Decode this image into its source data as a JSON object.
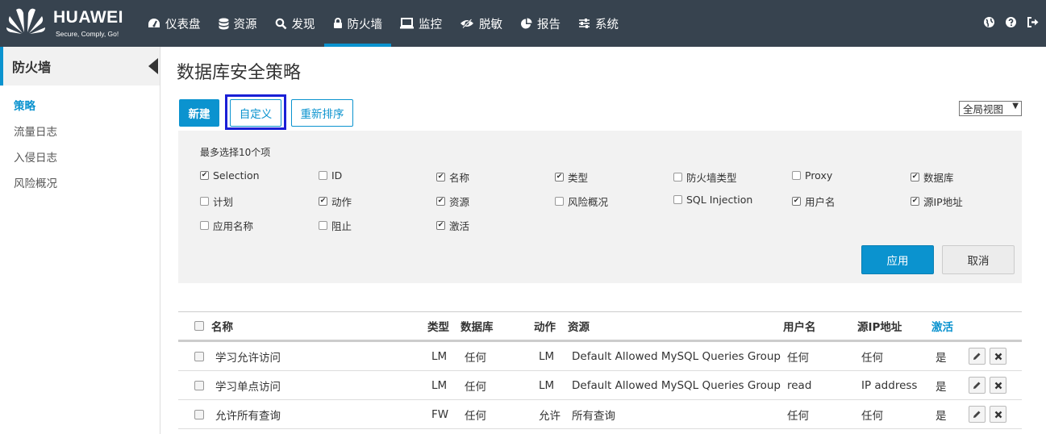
{
  "brand": {
    "name": "HUAWEI",
    "slogan": "Secure, Comply, Go!"
  },
  "nav": [
    {
      "label": "仪表盘",
      "icon": "dashboard-icon"
    },
    {
      "label": "资源",
      "icon": "database-icon"
    },
    {
      "label": "发现",
      "icon": "search-icon"
    },
    {
      "label": "防火墙",
      "icon": "lock-icon",
      "active": true
    },
    {
      "label": "监控",
      "icon": "monitor-icon"
    },
    {
      "label": "脱敏",
      "icon": "eye-slash-icon"
    },
    {
      "label": "报告",
      "icon": "pie-chart-icon"
    },
    {
      "label": "系统",
      "icon": "sliders-icon"
    }
  ],
  "top_icons": [
    "globe-icon",
    "help-icon",
    "logout-icon"
  ],
  "sidebar": {
    "title": "防火墙",
    "items": [
      {
        "label": "策略",
        "active": true
      },
      {
        "label": "流量日志"
      },
      {
        "label": "入侵日志"
      },
      {
        "label": "风险概况"
      }
    ]
  },
  "page": {
    "title": "数据库安全策略"
  },
  "toolbar": {
    "new_label": "新建",
    "custom_label": "自定义",
    "reorder_label": "重新排序"
  },
  "view_select": {
    "value": "全局视图"
  },
  "custom_panel": {
    "hint": "最多选择10个项",
    "options": [
      {
        "label": "Selection",
        "checked": true
      },
      {
        "label": "ID",
        "checked": false
      },
      {
        "label": "名称",
        "checked": true
      },
      {
        "label": "类型",
        "checked": true
      },
      {
        "label": "防火墙类型",
        "checked": false
      },
      {
        "label": "Proxy",
        "checked": false
      },
      {
        "label": "数据库",
        "checked": true
      },
      {
        "label": "计划",
        "checked": false
      },
      {
        "label": "动作",
        "checked": true
      },
      {
        "label": "资源",
        "checked": true
      },
      {
        "label": "风险概况",
        "checked": false
      },
      {
        "label": "SQL Injection",
        "checked": false
      },
      {
        "label": "用户名",
        "checked": true
      },
      {
        "label": "源IP地址",
        "checked": true
      },
      {
        "label": "应用名称",
        "checked": false
      },
      {
        "label": "阻止",
        "checked": false
      },
      {
        "label": "激活",
        "checked": true
      }
    ],
    "apply_label": "应用",
    "cancel_label": "取消"
  },
  "table": {
    "columns": [
      "名称",
      "类型",
      "数据库",
      "动作",
      "资源",
      "用户名",
      "源IP地址",
      "激活"
    ],
    "rows": [
      [
        "学习允许访问",
        "LM",
        "任何",
        "LM",
        "Default Allowed MySQL Queries Group",
        "任何",
        "任何",
        "是"
      ],
      [
        "学习单点访问",
        "LM",
        "任何",
        "LM",
        "Default Allowed MySQL Queries Group",
        "read",
        "IP address",
        "是"
      ],
      [
        "允许所有查询",
        "FW",
        "任何",
        "允许",
        "所有查询",
        "任何",
        "任何",
        "是"
      ]
    ]
  }
}
